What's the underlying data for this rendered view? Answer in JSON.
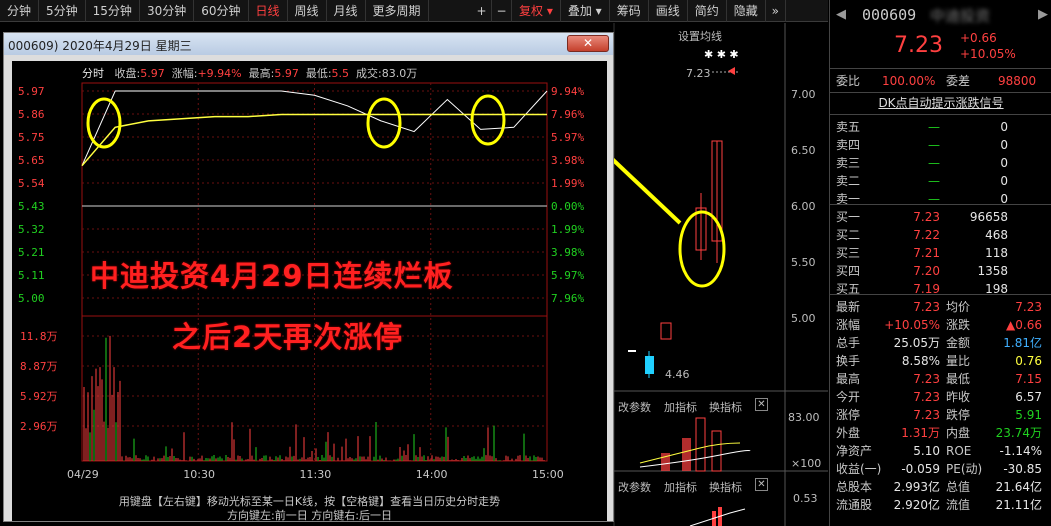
{
  "toolbar": {
    "left": [
      "分钟",
      "5分钟",
      "15分钟",
      "30分钟",
      "60分钟",
      "日线",
      "周线",
      "月线",
      "更多周期"
    ],
    "active": "日线",
    "right": [
      "+",
      "−",
      "复权",
      "叠加",
      "筹码",
      "画线",
      "简约",
      "隐藏"
    ],
    "more": "»"
  },
  "bg_chart": {
    "indicator_label": "设置均线",
    "marker_label": "7.23",
    "price_axis": [
      "7.00",
      "6.50",
      "6.00",
      "5.50",
      "5.00"
    ],
    "low_label": "4.46",
    "sub_tabs": [
      "改参数",
      "加指标",
      "换指标"
    ],
    "sub_tabs2": [
      "改参数",
      "加指标",
      "换指标"
    ],
    "vol_axis": [
      "83.00",
      "×100"
    ],
    "macd_axis": [
      "0.53"
    ]
  },
  "stock": {
    "code": "000609",
    "name": "中迪投资",
    "price": "7.23",
    "change": "+0.66",
    "pct": "+10.05%",
    "weibi_label": "委比",
    "weibi": "100.00%",
    "weicha_label": "委差",
    "weicha": "98800",
    "signal": "DK点自动提示涨跌信号",
    "sells": [
      {
        "label": "卖五",
        "price": "—",
        "vol": "0"
      },
      {
        "label": "卖四",
        "price": "—",
        "vol": "0"
      },
      {
        "label": "卖三",
        "price": "—",
        "vol": "0"
      },
      {
        "label": "卖二",
        "price": "—",
        "vol": "0"
      },
      {
        "label": "卖一",
        "price": "—",
        "vol": "0"
      }
    ],
    "buys": [
      {
        "label": "买一",
        "price": "7.23",
        "vol": "96658"
      },
      {
        "label": "买二",
        "price": "7.22",
        "vol": "468"
      },
      {
        "label": "买三",
        "price": "7.21",
        "vol": "118"
      },
      {
        "label": "买四",
        "price": "7.20",
        "vol": "1358"
      },
      {
        "label": "买五",
        "price": "7.19",
        "vol": "198"
      }
    ],
    "stats": [
      {
        "l1": "最新",
        "v1": "7.23",
        "c1": "r",
        "l2": "均价",
        "v2": "7.23",
        "c2": "r"
      },
      {
        "l1": "涨幅",
        "v1": "+10.05%",
        "c1": "r",
        "l2": "涨跌",
        "v2": "▲0.66",
        "c2": "r"
      },
      {
        "l1": "总手",
        "v1": "25.05万",
        "c1": "w",
        "l2": "金额",
        "v2": "1.81亿",
        "c2": "b"
      },
      {
        "l1": "换手",
        "v1": "8.58%",
        "c1": "w",
        "l2": "量比",
        "v2": "0.76",
        "c2": "y"
      },
      {
        "l1": "最高",
        "v1": "7.23",
        "c1": "r",
        "l2": "最低",
        "v2": "7.15",
        "c2": "r"
      },
      {
        "l1": "今开",
        "v1": "7.23",
        "c1": "r",
        "l2": "昨收",
        "v2": "6.57",
        "c2": "w"
      },
      {
        "l1": "涨停",
        "v1": "7.23",
        "c1": "r",
        "l2": "跌停",
        "v2": "5.91",
        "c2": "g"
      },
      {
        "l1": "外盘",
        "v1": "1.31万",
        "c1": "r",
        "l2": "内盘",
        "v2": "23.74万",
        "c2": "g"
      },
      {
        "l1": "净资产",
        "v1": "5.10",
        "c1": "w",
        "l2": "ROE",
        "v2": "-1.14%",
        "c2": "w"
      },
      {
        "l1": "收益(一)",
        "v1": "-0.059",
        "c1": "w",
        "l2": "PE(动)",
        "v2": "-30.85",
        "c2": "w"
      },
      {
        "l1": "总股本",
        "v1": "2.993亿",
        "c1": "w",
        "l2": "总值",
        "v2": "21.64亿",
        "c2": "w"
      },
      {
        "l1": "流通股",
        "v1": "2.920亿",
        "c1": "w",
        "l2": "流值",
        "v2": "21.11亿",
        "c2": "w"
      }
    ]
  },
  "popup": {
    "title": "000609) 2020年4月29日 星期三",
    "close": "✕",
    "header": {
      "fenshi": "分时",
      "shoupan_label": "收盘:",
      "shoupan": "5.97",
      "zhangfu_label": "涨幅:",
      "zhangfu": "+9.94%",
      "zuigao_label": "最高:",
      "zuigao": "5.97",
      "zuidi_label": "最低:",
      "zuidi": "5.5",
      "chengjiao_label": "成交:",
      "chengjiao": "83.0万"
    },
    "left_axis": [
      "5.97",
      "5.86",
      "5.75",
      "5.65",
      "5.54",
      "5.43",
      "5.32",
      "5.21",
      "5.11",
      "5.00"
    ],
    "right_axis": [
      "9.94%",
      "7.96%",
      "5.97%",
      "3.98%",
      "1.99%",
      "0.00%",
      "1.99%",
      "3.98%",
      "5.97%",
      "7.96%"
    ],
    "vol_axis": [
      "11.8万",
      "8.87万",
      "5.92万",
      "2.96万"
    ],
    "time_axis": [
      "04/29",
      "10:30",
      "11:30",
      "14:00",
      "15:00"
    ],
    "status1": "用键盘【左右键】移动光标至某一日K线，按【空格键】查看当日历史分时走势",
    "status2": "方向键左:前一日    方向键右:后一日"
  },
  "caption": {
    "line1": "中迪投资4月29日连续烂板",
    "line2": "之后2天再次涨停"
  },
  "colors": {
    "up": "#ff4040",
    "down": "#20d020",
    "price_line": "#ffffff",
    "avg_line": "#ffff40",
    "highlight": "#ffff00",
    "caption": "#ff2020"
  },
  "chart_data": {
    "type": "line",
    "title": "分时",
    "x": [
      "09:30",
      "09:45",
      "10:00",
      "10:30",
      "11:00",
      "11:30",
      "13:00",
      "13:15",
      "13:30",
      "13:45",
      "14:00",
      "14:15",
      "14:30",
      "14:45",
      "15:00"
    ],
    "series": [
      {
        "values": [
          5.62,
          5.97,
          5.97,
          5.97,
          5.97,
          5.97,
          5.97,
          5.95,
          5.9,
          5.83,
          5.78,
          5.93,
          5.79,
          5.8,
          5.97
        ]
      },
      {
        "values": [
          5.62,
          5.8,
          5.83,
          5.84,
          5.85,
          5.85,
          5.86,
          5.86,
          5.86,
          5.86,
          5.86,
          5.86,
          5.86,
          5.86,
          5.86
        ]
      }
    ],
    "ylim": [
      5.0,
      5.97
    ]
  }
}
